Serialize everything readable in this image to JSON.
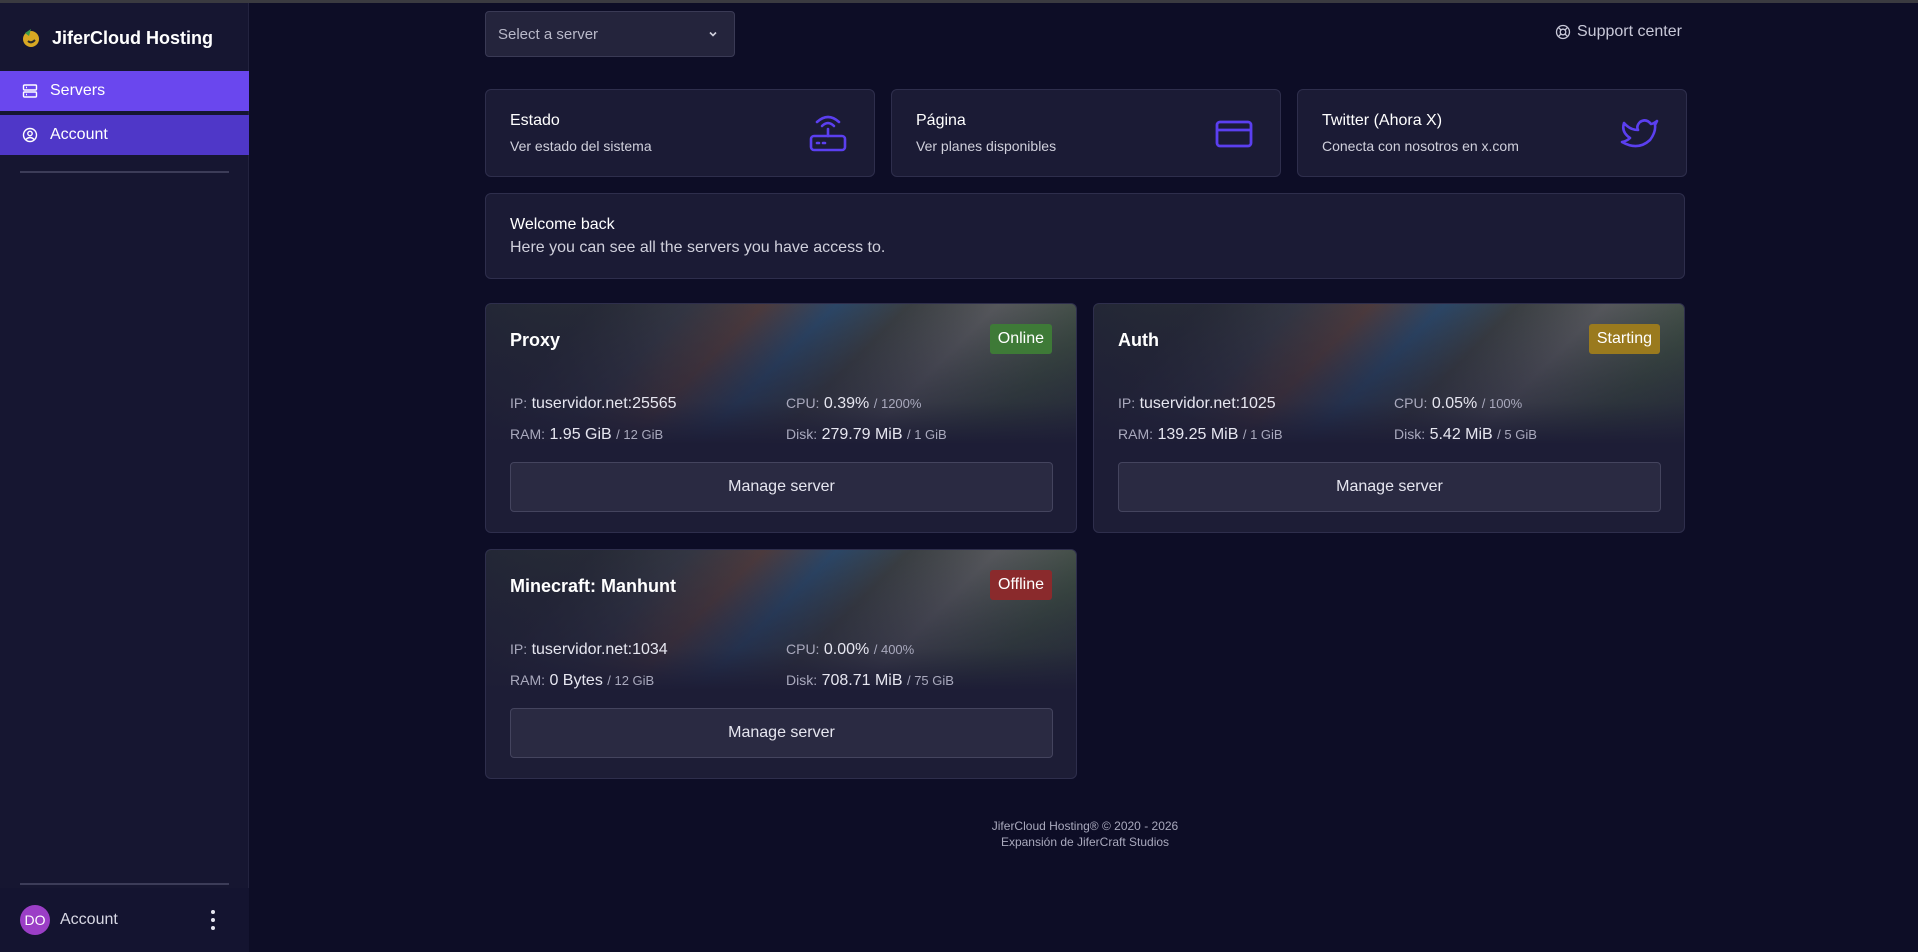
{
  "brand": {
    "name": "JiferCloud Hosting"
  },
  "sidebar": {
    "items": [
      {
        "label": "Servers",
        "icon": "server-icon"
      },
      {
        "label": "Account",
        "icon": "user-circle-icon"
      }
    ],
    "user": {
      "initials": "DO",
      "label": "Account"
    }
  },
  "topbar": {
    "select_placeholder": "Select a server",
    "support_label": "Support center"
  },
  "links": [
    {
      "title": "Estado",
      "subtitle": "Ver estado del sistema",
      "icon": "router-icon"
    },
    {
      "title": "Página",
      "subtitle": "Ver planes disponibles",
      "icon": "credit-card-icon"
    },
    {
      "title": "Twitter (Ahora X)",
      "subtitle": "Conecta con nosotros en x.com",
      "icon": "twitter-icon"
    }
  ],
  "welcome": {
    "title": "Welcome back",
    "subtitle": "Here you can see all the servers you have access to."
  },
  "labels": {
    "ip": "IP:",
    "cpu": "CPU:",
    "ram": "RAM:",
    "disk": "Disk:",
    "manage": "Manage server"
  },
  "servers": [
    {
      "name": "Proxy",
      "status": "Online",
      "ip": "tuservidor.net:25565",
      "cpu": "0.39%",
      "cpu_limit": "/ 1200%",
      "ram": "1.95 GiB",
      "ram_limit": "/ 12 GiB",
      "disk": "279.79 MiB",
      "disk_limit": "/ 1 GiB"
    },
    {
      "name": "Auth",
      "status": "Starting",
      "ip": "tuservidor.net:1025",
      "cpu": "0.05%",
      "cpu_limit": "/ 100%",
      "ram": "139.25 MiB",
      "ram_limit": "/ 1 GiB",
      "disk": "5.42 MiB",
      "disk_limit": "/ 5 GiB"
    },
    {
      "name": "Minecraft: Manhunt",
      "status": "Offline",
      "ip": "tuservidor.net:1034",
      "cpu": "0.00%",
      "cpu_limit": "/ 400%",
      "ram": "0 Bytes",
      "ram_limit": "/ 12 GiB",
      "disk": "708.71 MiB",
      "disk_limit": "/ 75 GiB"
    }
  ],
  "footer": {
    "line1": "JiferCloud Hosting® © 2020 - 2026",
    "line2": "Expansión de JiferCraft Studios"
  },
  "colors": {
    "accent": "#6a47ee",
    "online": "#3e7a37",
    "starting": "#9a7a1e",
    "offline": "#8a2a2c",
    "icon": "#5b3ff0"
  }
}
